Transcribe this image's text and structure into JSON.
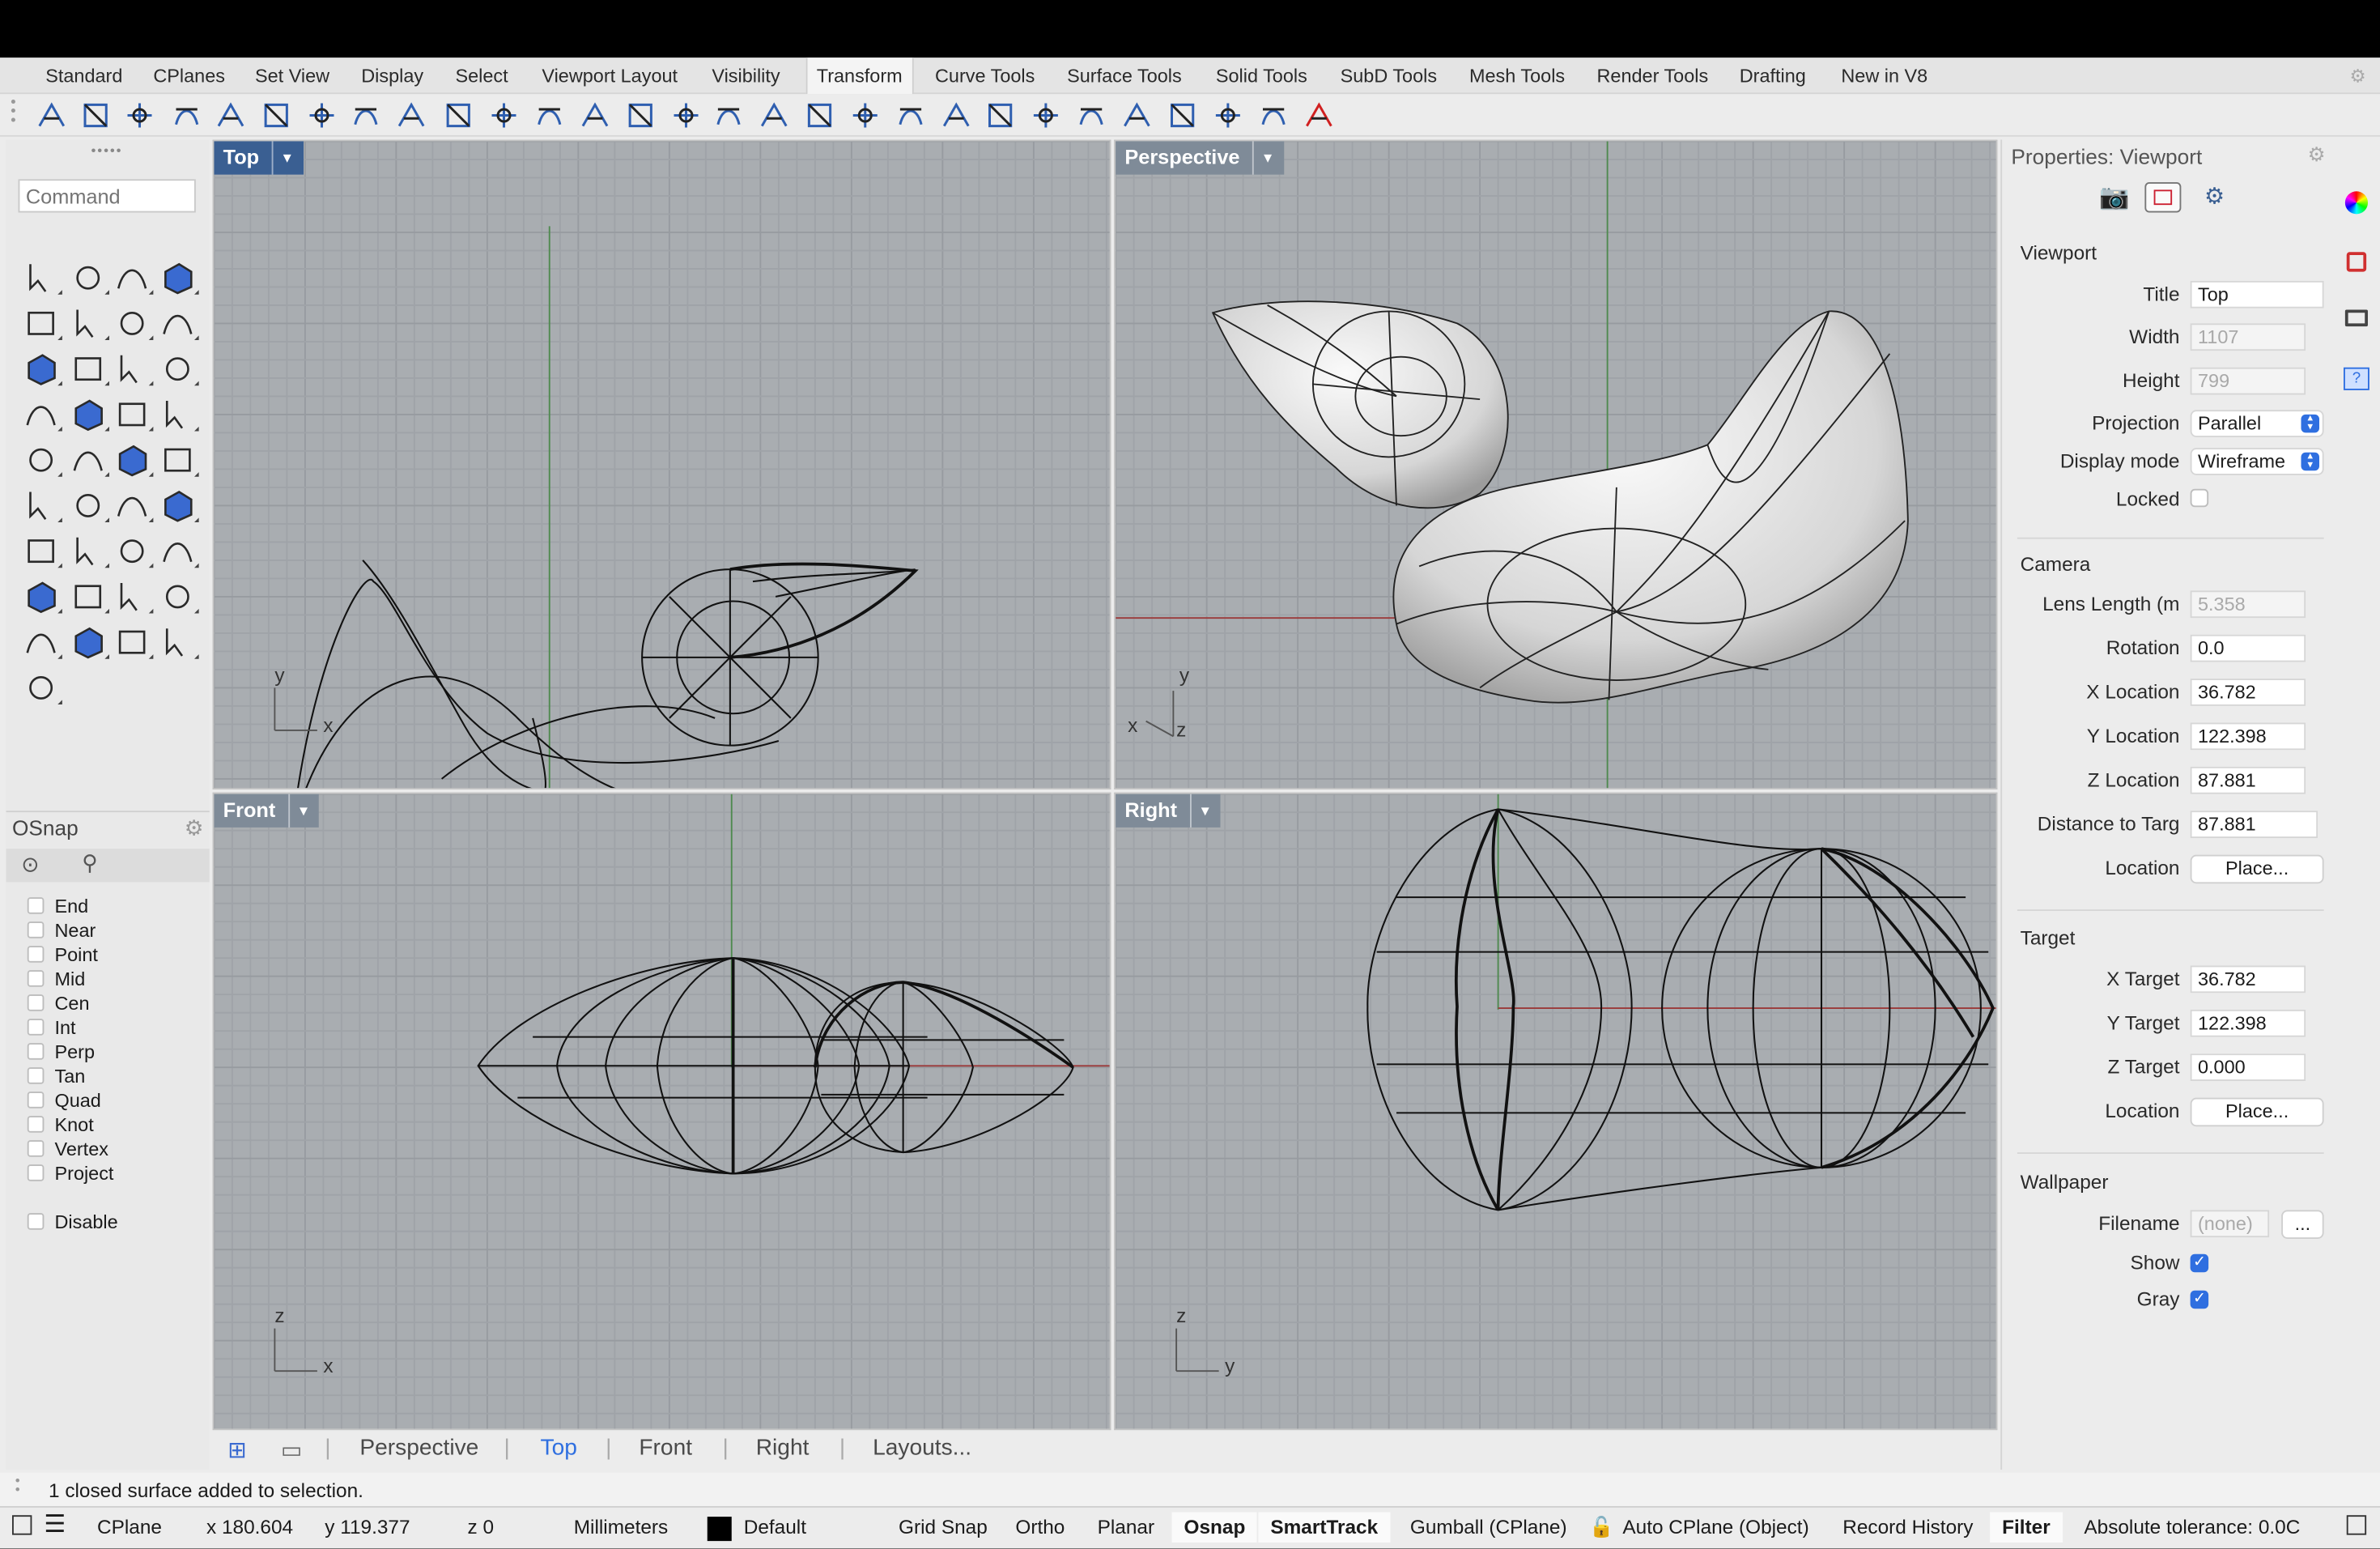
{
  "menu_tabs": [
    "Standard",
    "CPlanes",
    "Set View",
    "Display",
    "Select",
    "Viewport Layout",
    "Visibility",
    "Transform",
    "Curve Tools",
    "Surface Tools",
    "Solid Tools",
    "SubD Tools",
    "Mesh Tools",
    "Render Tools",
    "Drafting",
    "New in V8"
  ],
  "active_tab": "Transform",
  "command": {
    "placeholder": "Command"
  },
  "osnap": {
    "title": "OSnap",
    "items": [
      "End",
      "Near",
      "Point",
      "Mid",
      "Cen",
      "Int",
      "Perp",
      "Tan",
      "Quad",
      "Knot",
      "Vertex",
      "Project"
    ],
    "disable": "Disable"
  },
  "viewports": {
    "top": {
      "label": "Top",
      "axis1": "y",
      "axis2": "x"
    },
    "perspective": {
      "label": "Perspective",
      "axis1": "y",
      "axis2": "x",
      "axis3": "z"
    },
    "front": {
      "label": "Front",
      "axis1": "z",
      "axis2": "x"
    },
    "right": {
      "label": "Right",
      "axis1": "z",
      "axis2": "y"
    }
  },
  "viewport_tabs": [
    "Perspective",
    "Top",
    "Front",
    "Right",
    "Layouts..."
  ],
  "active_viewport_tab": "Top",
  "properties": {
    "title": "Properties: Viewport",
    "viewport": {
      "section": "Viewport",
      "title_label": "Title",
      "title_value": "Top",
      "width_label": "Width",
      "width_value": "1107",
      "height_label": "Height",
      "height_value": "799",
      "projection_label": "Projection",
      "projection_value": "Parallel",
      "display_label": "Display mode",
      "display_value": "Wireframe",
      "locked_label": "Locked"
    },
    "camera": {
      "section": "Camera",
      "lens_label": "Lens Length (m",
      "lens_value": "5.358",
      "rotation_label": "Rotation",
      "rotation_value": "0.0",
      "xloc_label": "X Location",
      "xloc_value": "36.782",
      "yloc_label": "Y Location",
      "yloc_value": "122.398",
      "zloc_label": "Z Location",
      "zloc_value": "87.881",
      "dist_label": "Distance to Targ",
      "dist_value": "87.881",
      "location_label": "Location",
      "place_button": "Place..."
    },
    "target": {
      "section": "Target",
      "xt_label": "X Target",
      "xt_value": "36.782",
      "yt_label": "Y Target",
      "yt_value": "122.398",
      "zt_label": "Z Target",
      "zt_value": "0.000",
      "location_label": "Location",
      "place_button": "Place..."
    },
    "wallpaper": {
      "section": "Wallpaper",
      "filename_label": "Filename",
      "filename_value": "(none)",
      "browse_button": "...",
      "show_label": "Show",
      "gray_label": "Gray"
    }
  },
  "command_history": "1 closed surface added to selection.",
  "status": {
    "cplane": "CPlane",
    "x": "x 180.604",
    "y": "y 119.377",
    "z": "z 0",
    "units": "Millimeters",
    "layer": "Default",
    "grid_snap": "Grid Snap",
    "ortho": "Ortho",
    "planar": "Planar",
    "osnap": "Osnap",
    "smarttrack": "SmartTrack",
    "gumball": "Gumball (CPlane)",
    "auto_cplane": "Auto CPlane (Object)",
    "record_history": "Record History",
    "filter": "Filter",
    "tolerance": "Absolute tolerance: 0.0C"
  },
  "colors": {
    "accent": "#3a5f92",
    "viewport_bg": "#a9adb1",
    "checkbox_blue": "#2f6fe0"
  }
}
